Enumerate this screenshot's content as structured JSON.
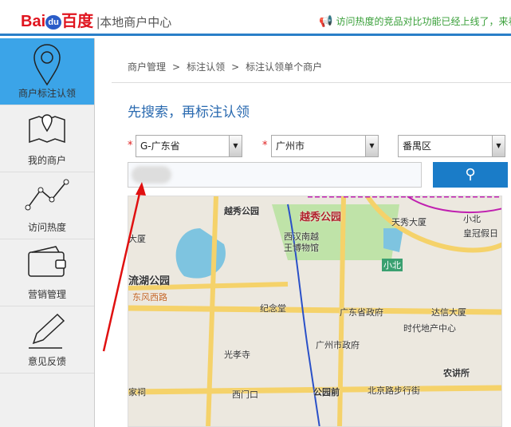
{
  "header": {
    "logo_text": "Bai",
    "logo_du": "du",
    "logo_cn": "百度",
    "subtitle": "本地商户中心",
    "notice": "访问热度的竞品对比功能已经上线了，来看"
  },
  "sidebar": {
    "items": [
      {
        "label": "商户标注认领",
        "icon": "map-pin-icon",
        "active": true
      },
      {
        "label": "我的商户",
        "icon": "map-icon"
      },
      {
        "label": "访问热度",
        "icon": "line-chart-icon"
      },
      {
        "label": "营销管理",
        "icon": "wallet-icon"
      },
      {
        "label": "意见反馈",
        "icon": "pencil-icon"
      }
    ]
  },
  "breadcrumb": [
    "商户管理",
    "标注认领",
    "标注认领单个商户"
  ],
  "breadcrumb_sep": ">",
  "page_title": "先搜索，再标注认领",
  "form": {
    "province": "G-广东省",
    "city": "广州市",
    "district": "番禺区",
    "required_mark": "*",
    "search_value": ""
  },
  "map": {
    "labels": [
      "越秀公园",
      "越秀公园",
      "天秀大厦",
      "小北",
      "皇冠假日",
      "西汉南越",
      "王博物馆",
      "大厦",
      "流湖公园",
      "东风西路",
      "小北",
      "纪念堂",
      "广东省政府",
      "达信大厦",
      "时代地产中心",
      "广州市政府",
      "光孝寺",
      "农讲所",
      "家祠",
      "西门口",
      "公园前",
      "北京路步行街"
    ]
  }
}
